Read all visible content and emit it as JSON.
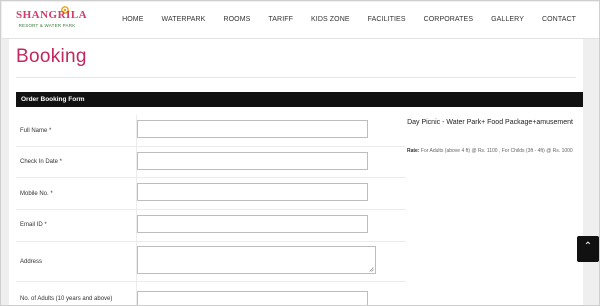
{
  "brand": {
    "name": "SHANGRILA",
    "tagline": "RESORT & WATER PARK"
  },
  "nav": [
    {
      "label": "HOME"
    },
    {
      "label": "WATERPARK"
    },
    {
      "label": "ROOMS"
    },
    {
      "label": "TARIFF"
    },
    {
      "label": "KIDS ZONE"
    },
    {
      "label": "FACILITIES"
    },
    {
      "label": "CORPORATES"
    },
    {
      "label": "GALLERY"
    },
    {
      "label": "CONTACT"
    }
  ],
  "page": {
    "title": "Booking"
  },
  "form": {
    "header": "Order Booking Form",
    "fields": [
      {
        "label": "Full Name *",
        "value": ""
      },
      {
        "label": "Check In Date *",
        "value": ""
      },
      {
        "label": "Mobile No. *",
        "value": ""
      },
      {
        "label": "Email ID *",
        "value": ""
      },
      {
        "label": "Address",
        "value": ""
      },
      {
        "label": "No. of Adults (10 years and above)",
        "value": ""
      }
    ]
  },
  "package": {
    "title": "Day Picnic - Water Park+ Food Package+amusement",
    "rate_label": "Rate:",
    "rate_text": " For Adults (above 4 ft) @ Rs. 1100 , For Childs (3ft - 4ft) @ Rs. 1000"
  },
  "scroll_top": {
    "icon": "chevron-up-icon",
    "glyph": "⌃"
  },
  "colors": {
    "accent": "#c2275f",
    "bar": "#111111"
  }
}
